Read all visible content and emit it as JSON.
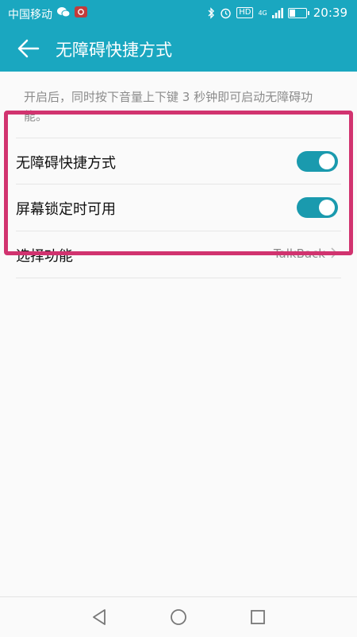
{
  "status_bar": {
    "carrier": "中国移动",
    "hd_badge": "HD",
    "network": "4G",
    "time": "20:39",
    "battery_level_percent": 40,
    "icons": [
      "wechat-icon",
      "app-notification-icon",
      "bluetooth-icon",
      "alarm-icon",
      "hd-icon",
      "signal-icon",
      "battery-icon"
    ]
  },
  "app_bar": {
    "title": "无障碍快捷方式",
    "back_icon": "back-arrow-icon"
  },
  "description": "开启后，同时按下音量上下键 3 秒钟即可启动无障碍功能。",
  "settings": [
    {
      "label": "无障碍快捷方式",
      "type": "toggle",
      "on": true
    },
    {
      "label": "屏幕锁定时可用",
      "type": "toggle",
      "on": true
    },
    {
      "label": "选择功能",
      "type": "link",
      "value": "TalkBack"
    }
  ],
  "nav_bar": {
    "buttons": [
      "back-triangle-icon",
      "home-circle-icon",
      "recents-square-icon"
    ]
  },
  "colors": {
    "app_bar": "#1aa7c0",
    "toggle_on": "#1a9aae",
    "highlight_frame": "#d1336f"
  }
}
